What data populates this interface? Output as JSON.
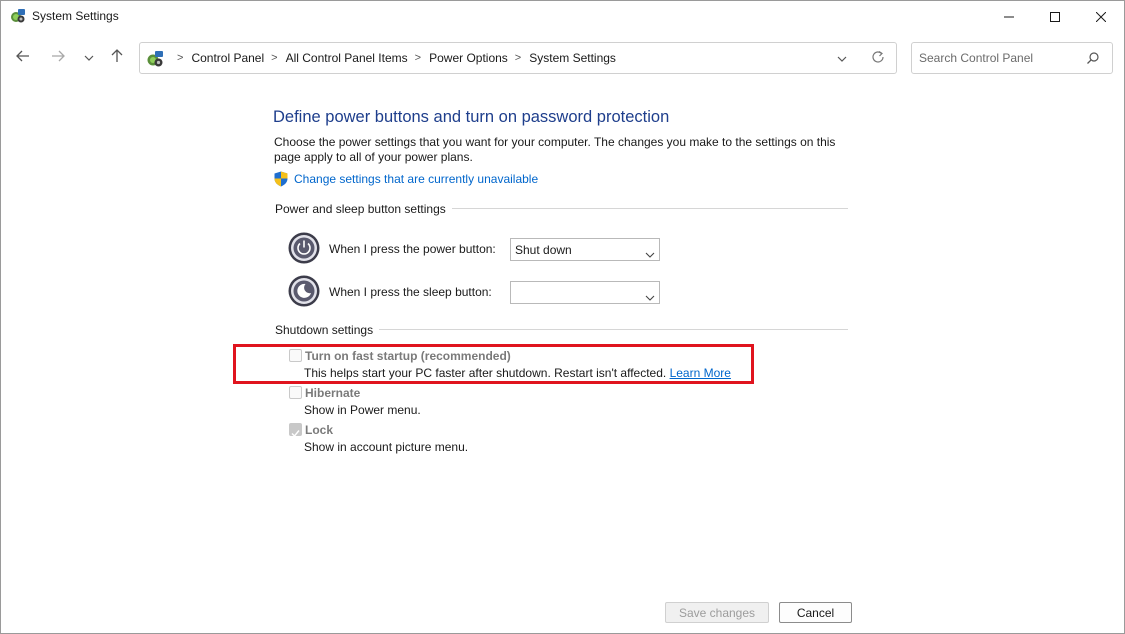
{
  "window": {
    "title": "System Settings",
    "minimize_icon": "minimize-icon",
    "maximize_icon": "maximize-icon",
    "close_icon": "close-icon"
  },
  "nav": {
    "back_icon": "arrow-left-icon",
    "forward_icon": "arrow-right-icon",
    "recent_icon": "chevron-down-icon",
    "up_icon": "arrow-up-icon"
  },
  "address": {
    "icon": "control-panel-icon",
    "breadcrumbs": [
      "Control Panel",
      "All Control Panel Items",
      "Power Options",
      "System Settings"
    ],
    "separator": ">",
    "dropdown_icon": "chevron-down-icon",
    "refresh_icon": "refresh-icon"
  },
  "search": {
    "placeholder": "Search Control Panel",
    "value": "",
    "icon": "search-icon"
  },
  "main": {
    "heading": "Define power buttons and turn on password protection",
    "description": "Choose the power settings that you want for your computer. The changes you make to the settings on this page apply to all of your power plans.",
    "change_link": "Change settings that are currently unavailable",
    "shield_icon": "uac-shield-icon"
  },
  "power_section": {
    "label": "Power and sleep button settings",
    "power_button": {
      "label": "When I press the power button:",
      "value": "Shut down",
      "icon": "power-button-icon"
    },
    "sleep_button": {
      "label": "When I press the sleep button:",
      "value": "",
      "icon": "sleep-button-icon"
    }
  },
  "shutdown_section": {
    "label": "Shutdown settings",
    "options": [
      {
        "title": "Turn on fast startup (recommended)",
        "description": "This helps start your PC faster after shutdown. Restart isn't affected.",
        "link": "Learn More",
        "checked": false
      },
      {
        "title": "Hibernate",
        "description": "Show in Power menu.",
        "checked": false
      },
      {
        "title": "Lock",
        "description": "Show in account picture menu.",
        "checked": true
      }
    ],
    "highlight_color": "#e0141e"
  },
  "footer": {
    "save_label": "Save changes",
    "cancel_label": "Cancel"
  },
  "colors": {
    "heading": "#1e3e8c",
    "link": "#0066cc",
    "disabled_text": "#7a7a7a"
  }
}
